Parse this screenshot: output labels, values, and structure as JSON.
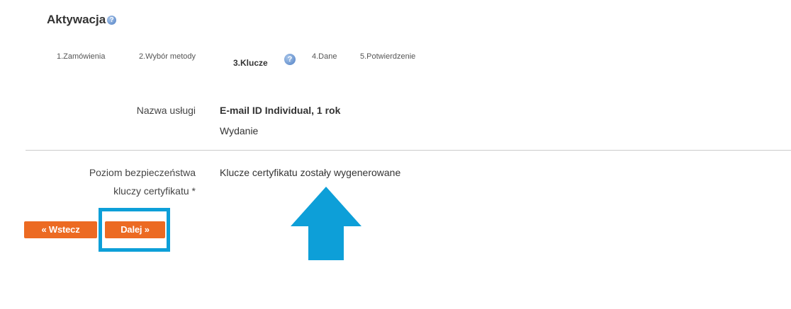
{
  "page": {
    "title": "Aktywacja",
    "help_icon": "question-help-icon"
  },
  "steps": [
    {
      "label": "1.Zamówienia"
    },
    {
      "label": "2.Wybór metody"
    },
    {
      "label": "3.Klucze",
      "active": true
    },
    {
      "label": "4.Dane"
    },
    {
      "label": "5.Potwierdzenie"
    }
  ],
  "form": {
    "service_label": "Nazwa usługi",
    "service_name": "E-mail ID Individual, 1 rok",
    "service_type": "Wydanie",
    "security_label_line1": "Poziom bezpieczeństwa",
    "security_label_line2": "kluczy certyfikatu *",
    "security_value": "Klucze certyfikatu zostały wygenerowane"
  },
  "buttons": {
    "back_label": "« Wstecz",
    "next_label": "Dalej »"
  },
  "colors": {
    "button": "#ec6a22",
    "annotation": "#0d9fd8",
    "help_icon": "#4f7fc4"
  }
}
